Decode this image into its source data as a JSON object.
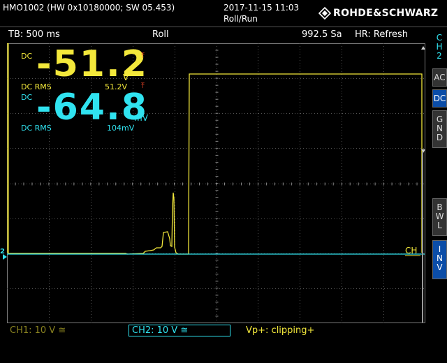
{
  "header": {
    "model": "HMO1002 (HW 0x10180000; SW 05.453)",
    "datetime": "2017-11-15 11:03",
    "mode": "Roll/Run",
    "brand": "ROHDE&SCHWARZ"
  },
  "infobar": {
    "timebase": "TB: 500 ms",
    "acq": "Roll",
    "samplerate": "992.5 Sa",
    "hr": "HR: Refresh"
  },
  "meas": {
    "ch1": {
      "coupling": "DC",
      "value": "-51.2",
      "unit": "V",
      "rms_label": "DC RMS",
      "rms_value": "51.2V"
    },
    "ch2": {
      "coupling": "DC",
      "value": "-64.8",
      "unit": "mV",
      "rms_label": "DC RMS",
      "rms_value": "104mV"
    }
  },
  "side": {
    "ch_label": [
      "C",
      "H",
      "2"
    ],
    "ac": "AC",
    "dc": "DC",
    "gnd": [
      "G",
      "N",
      "D"
    ],
    "bwl": [
      "B",
      "W",
      "L"
    ],
    "inv": [
      "I",
      "N",
      "V"
    ]
  },
  "ch_marker": "CH",
  "ch_ref": "2",
  "footer": {
    "ch1": "CH1: 10 V ≅",
    "ch2": "CH2: 10 V ≅",
    "vp": "Vp+: clipping+"
  },
  "colors": {
    "ch1": "#f3e83b",
    "ch2": "#30e3f0",
    "warn": "#ff4a2a",
    "active": "#0b4da8"
  }
}
